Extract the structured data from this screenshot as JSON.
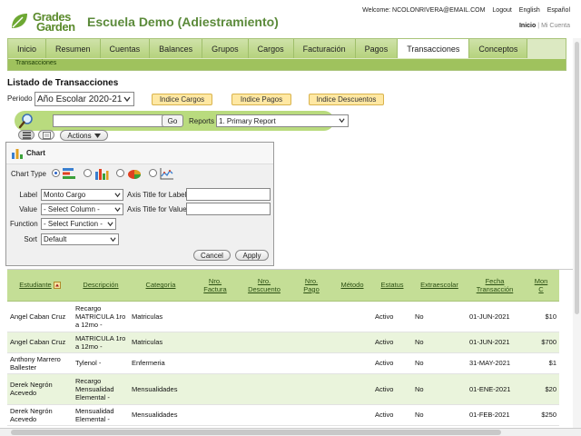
{
  "brand": {
    "line1": "Grades",
    "line2": "Garden",
    "school": "Escuela Demo (Adiestramiento)"
  },
  "top_links": {
    "welcome": "Welcome: NCOLONRIVERA@EMAIL.COM",
    "logout": "Logout",
    "english": "English",
    "espanol": "Español",
    "inicio": "Inicio",
    "separator": "|",
    "mi_cuenta": "Mi Cuenta"
  },
  "nav": {
    "tabs": [
      "Inicio",
      "Resumen",
      "Cuentas",
      "Balances",
      "Grupos",
      "Cargos",
      "Facturación",
      "Pagos",
      "Transacciones",
      "Conceptos"
    ],
    "active": "Transacciones",
    "sub": "Transacciones"
  },
  "page": {
    "title": "Listado de Transacciones",
    "periodo_label": "Periodo",
    "periodo_value": "Año Escolar 2020-21"
  },
  "index_buttons": {
    "cargos": "Indice Cargos",
    "pagos": "Indice Pagos",
    "descuentos": "Indice Descuentos"
  },
  "search": {
    "go": "Go",
    "reports_label": "Reports",
    "reports_value": "1. Primary Report"
  },
  "actions_label": "Actions",
  "chart_panel": {
    "title": "Chart",
    "chart_type_label": "Chart Type",
    "label_label": "Label",
    "label_value": "Monto Cargo",
    "value_label": "Value",
    "value_value": "- Select Column -",
    "function_label": "Function",
    "function_value": "- Select Function -",
    "sort_label": "Sort",
    "sort_value": "Default",
    "axis_label_title": "Axis Title for Label",
    "axis_value_title": "Axis Title for Value",
    "cancel": "Cancel",
    "apply": "Apply"
  },
  "table": {
    "headers": [
      "Estudiante",
      "Descripción",
      "Categoría",
      "Nro. Factura",
      "Nro. Descuento",
      "Nro. Pago",
      "Método",
      "Estatus",
      "Extraescolar",
      "Fecha Transacción",
      "Monto Cargo"
    ],
    "header_visible": {
      "Nro. Factura": [
        "Nro.",
        "Factura"
      ],
      "Nro. Descuento": [
        "Nro.",
        "Descuento"
      ],
      "Nro. Pago": [
        "Nro.",
        "Pago"
      ],
      "Fecha Transacción": [
        "Fecha",
        "Transacción"
      ],
      "Monto Cargo": [
        "Mon",
        "C"
      ]
    },
    "rows": [
      {
        "estudiante": "Angel Caban Cruz",
        "descripcion": "Recargo MATRICULA 1ro a 12mo -",
        "categoria": "Matriculas",
        "estatus": "Activo",
        "extra": "No",
        "fecha": "01-JUN-2021",
        "monto": "$10"
      },
      {
        "estudiante": "Angel Caban Cruz",
        "descripcion": "MATRICULA 1ro a 12mo -",
        "categoria": "Matriculas",
        "estatus": "Activo",
        "extra": "No",
        "fecha": "01-JUN-2021",
        "monto": "$700"
      },
      {
        "estudiante": "Anthony Marrero Ballester",
        "descripcion": "Tylenol -",
        "categoria": "Enfermeria",
        "estatus": "Activo",
        "extra": "No",
        "fecha": "31-MAY-2021",
        "monto": "$1"
      },
      {
        "estudiante": "Derek Negrón Acevedo",
        "descripcion": "Recargo Mensualidad Elemental -",
        "categoria": "Mensualidades",
        "estatus": "Activo",
        "extra": "No",
        "fecha": "01-ENE-2021",
        "monto": "$20"
      },
      {
        "estudiante": "Derek Negrón Acevedo",
        "descripcion": "Mensualidad Elemental -",
        "categoria": "Mensualidades",
        "estatus": "Activo",
        "extra": "No",
        "fecha": "01-FEB-2021",
        "monto": "$250"
      }
    ]
  },
  "colors": {
    "brand_green": "#5a8a2b",
    "nav_green": "#b5d27c",
    "header_green": "#c4de96",
    "row_alt": "#eaf4dc",
    "index_yellow": "#ffe8a3"
  }
}
